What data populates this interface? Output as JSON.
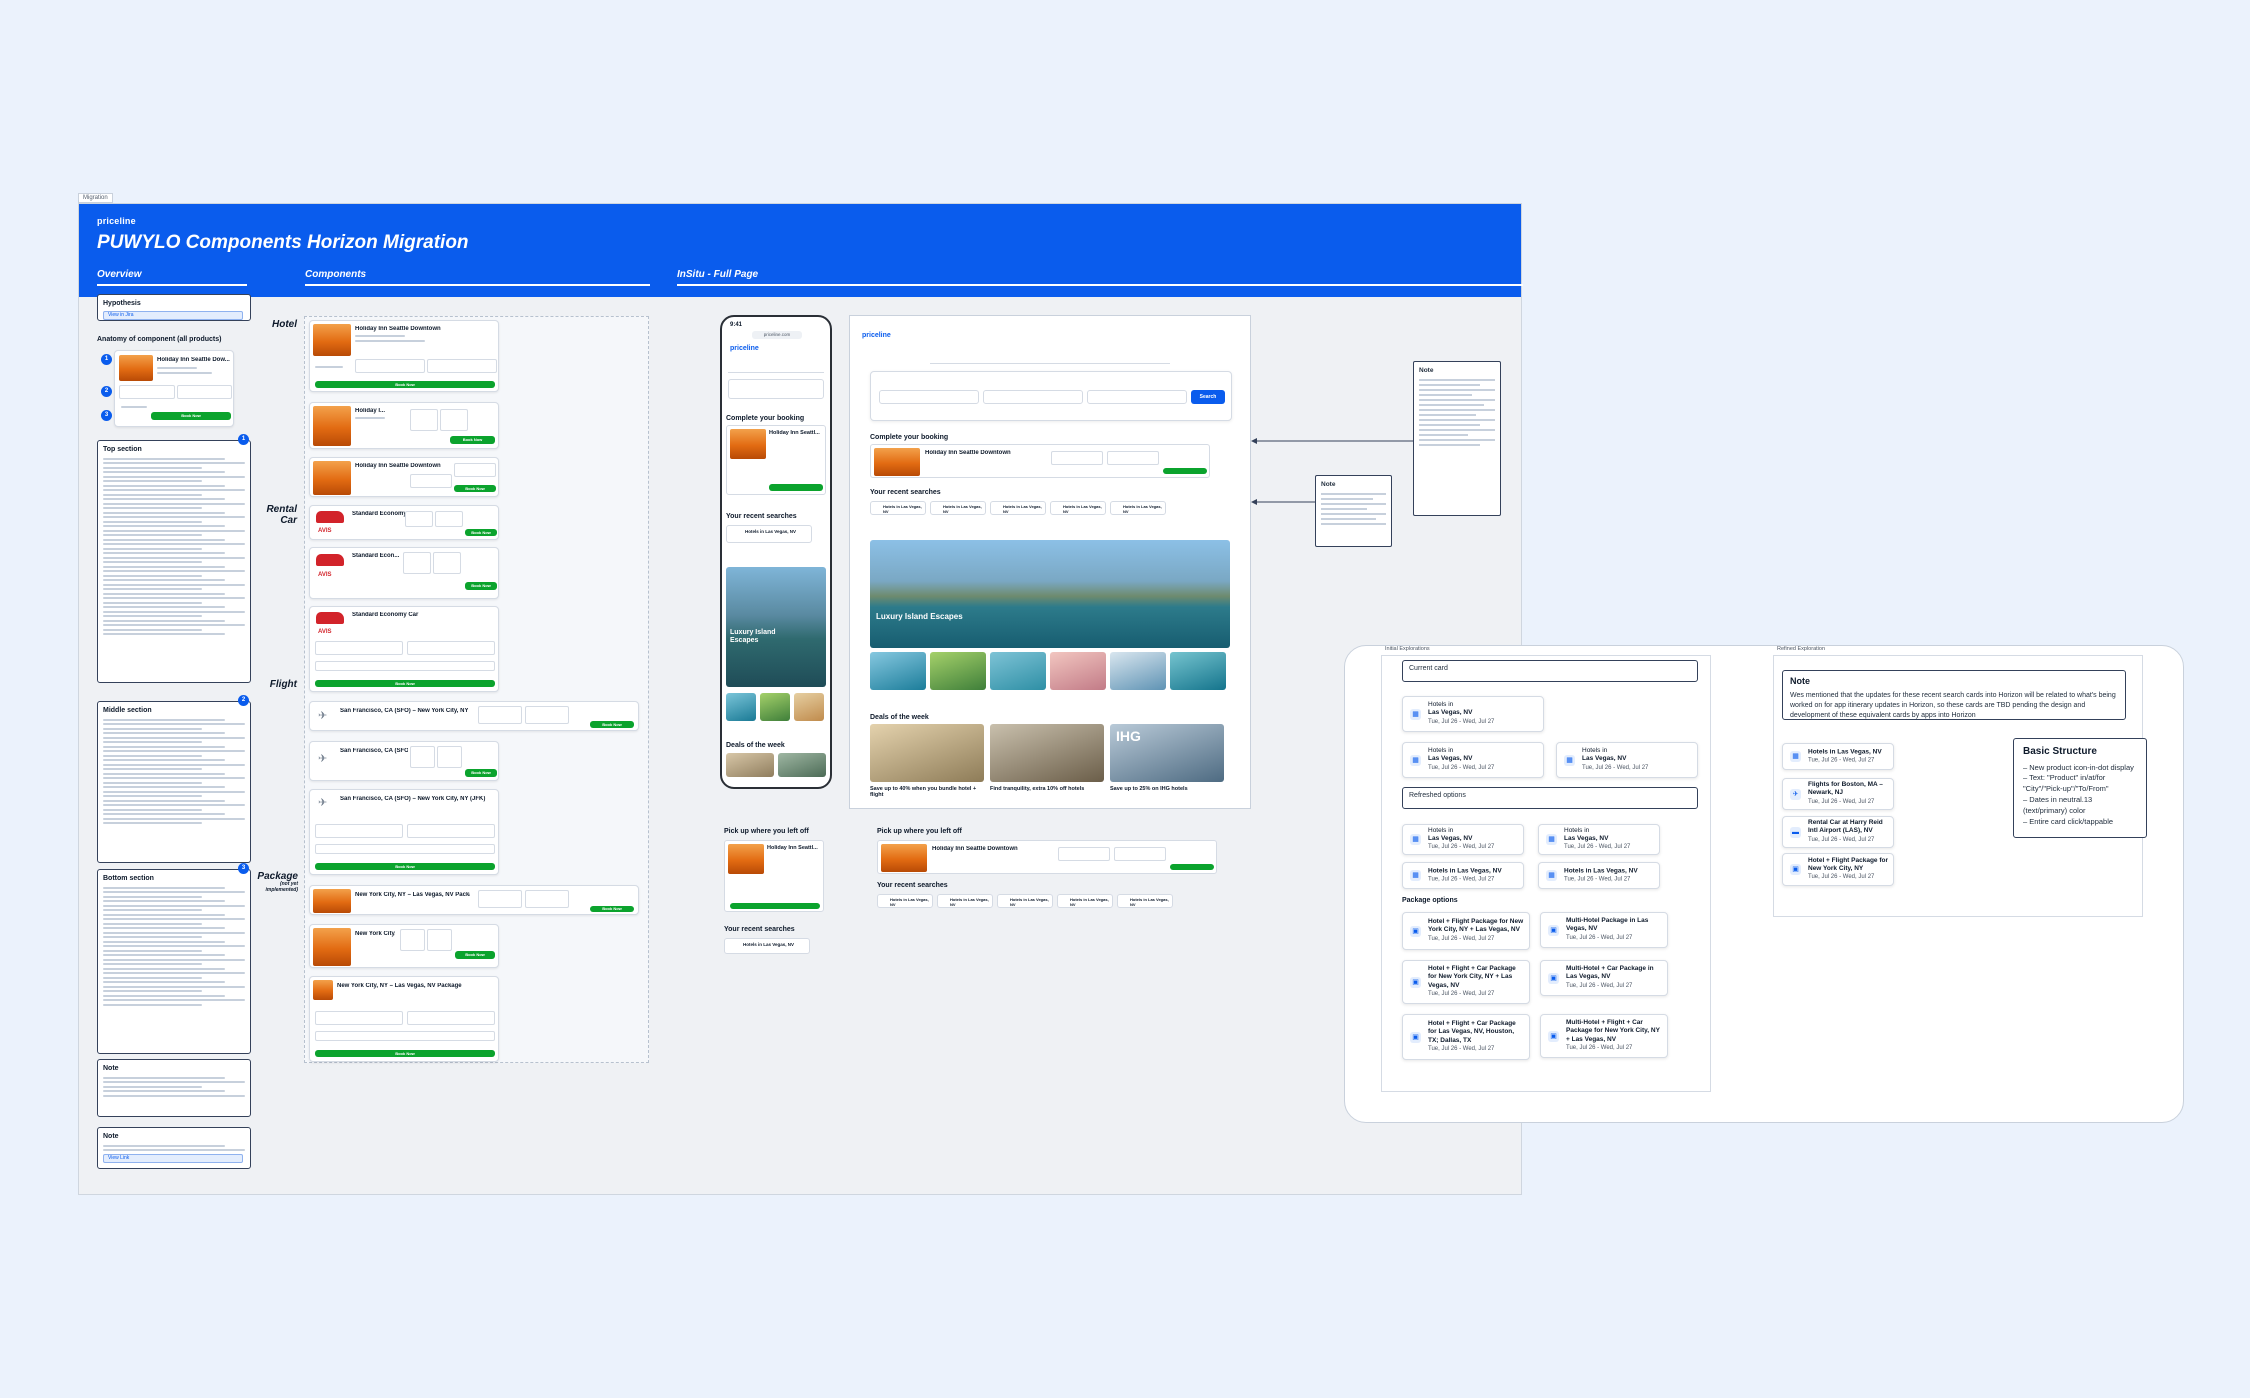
{
  "board": {
    "tag": "Migration",
    "brand": "priceline",
    "title": "PUWYLO Components Horizon Migration",
    "sections": {
      "overview": "Overview",
      "components": "Components",
      "insitu": "InSitu - Full Page"
    }
  },
  "overview": {
    "hypothesis_title": "Hypothesis",
    "hypothesis_link": "View in Jira",
    "anatomy_title": "Anatomy of component (all products)",
    "anatomy_hotel": "Holiday Inn Seattle Dow...",
    "anatomy_button": "Book Now",
    "numbers": [
      "1",
      "2",
      "3"
    ],
    "top_section_title": "Top section",
    "middle_section_title": "Middle section",
    "bottom_section_title": "Bottom section",
    "note_title": "Note",
    "note2_title": "Note",
    "note2_link": "View Link"
  },
  "components": {
    "categories": {
      "hotel": "Hotel",
      "car": "Rental Car",
      "flight": "Flight",
      "package": "Package",
      "package_sub": "(not yet implemented)"
    },
    "hotel_cards": [
      "Holiday Inn Seattle Downtown",
      "Holiday I...",
      "Holiday Inn Seattle Downtown"
    ],
    "car_cards": [
      "Standard Economy Car",
      "Standard Econ...",
      "Standard Economy Car"
    ],
    "flight_cards": [
      "San Francisco, CA (SFO) – New York City, NY (JFK)",
      "San Francisco, CA (SFO) – Ne...",
      "San Francisco, CA (SFO) – New York City, NY (JFK)"
    ],
    "package_cards": [
      "New York City, NY – Las Vegas, NV Package",
      "New York City, NY...",
      "New York City, NY – Las Vegas, NV Package"
    ],
    "book_now": "Book Now",
    "avis": "AVIS"
  },
  "mobile": {
    "time": "9:41",
    "url": "priceline.com",
    "brand": "priceline",
    "complete_booking": "Complete your booking",
    "hotel_name": "Holiday Inn Seattl...",
    "recent_searches": "Your recent searches",
    "recent_item": "Hotels in Las Vegas, NV",
    "hero_title": "Luxury Island Escapes",
    "deals": "Deals of the week",
    "pick_up": "Pick up where you left off",
    "recent_searches_2": "Your recent searches"
  },
  "desktop": {
    "brand": "priceline",
    "complete_booking": "Complete your booking",
    "hotel_name": "Holiday Inn Seattle Downtown",
    "recent_searches": "Your recent searches",
    "recent_item": "Hotels in Las Vegas, NV",
    "hero_title": "Luxury Island Escapes",
    "deals": "Deals of the week",
    "deal_captions": [
      "Save up to 40% when you bundle hotel + flight",
      "Find tranquility, extra 10% off hotels",
      "Save up to 25% on IHG hotels"
    ],
    "ihg": "IHG",
    "pick_up": "Pick up where you left off",
    "pick_hotel": "Holiday Inn Seattle Downtown",
    "recent_searches_2": "Your recent searches",
    "search_button": "Search"
  },
  "notes": {
    "note_a_title": "Note",
    "note_b_title": "Note"
  },
  "exploration": {
    "initial_tag": "Initial Explorations",
    "refined_tag": "Refined Exploration",
    "current_card": "Current card",
    "refreshed_options": "Refreshed options",
    "package_options": "Package options",
    "current_cards": [
      {
        "l1": "Hotels in",
        "l1b": "Las Vegas, NV",
        "l2": "Tue, Jul 26 - Wed, Jul 27"
      },
      {
        "l1": "Hotels in",
        "l1b": "Las Vegas, NV",
        "l2": "Tue, Jul 26 - Wed, Jul 27"
      },
      {
        "l1": "Hotels in",
        "l1b": "Las Vegas, NV",
        "l2": "Tue, Jul 26 - Wed, Jul 27"
      }
    ],
    "refreshed_cards": [
      {
        "l1": "Hotels in",
        "l1b": "Las Vegas, NV",
        "l2": "Tue, Jul 26 - Wed, Jul 27"
      },
      {
        "l1": "Hotels in",
        "l1b": "Las Vegas, NV",
        "l2": "Tue, Jul 26 - Wed, Jul 27"
      },
      {
        "l1": "",
        "l1b": "Hotels in Las Vegas, NV",
        "l2": "Tue, Jul 26 - Wed, Jul 27"
      },
      {
        "l1": "",
        "l1b": "Hotels in Las Vegas, NV",
        "l2": "Tue, Jul 26 - Wed, Jul 27"
      }
    ],
    "package_cards": [
      {
        "l1b": "Hotel + Flight Package for New York City, NY + Las Vegas, NV",
        "l2": "Tue, Jul 26 - Wed, Jul 27"
      },
      {
        "l1b": "Multi-Hotel Package in Las Vegas, NV",
        "l2": "Tue, Jul 26 - Wed, Jul 27"
      },
      {
        "l1b": "Hotel + Flight + Car Package for New York City, NY + Las Vegas, NV",
        "l2": "Tue, Jul 26 - Wed, Jul 27"
      },
      {
        "l1b": "Multi-Hotel + Car Package in Las Vegas, NV",
        "l2": "Tue, Jul 26 - Wed, Jul 27"
      },
      {
        "l1b": "Hotel + Flight + Car Package for Las Vegas, NV, Houston, TX; Dallas, TX",
        "l2": "Tue, Jul 26 - Wed, Jul 27"
      },
      {
        "l1b": "Multi-Hotel + Flight + Car Package for New York City, NY + Las Vegas, NV",
        "l2": "Tue, Jul 26 - Wed, Jul 27"
      }
    ],
    "refined_note_title": "Note",
    "refined_note_text": "Wes mentioned that the updates for these recent search cards into Horizon will be related to what's being worked on for app itinerary updates in Horizon, so these cards are TBD pending the design and development of these equivalent cards by apps into Horizon",
    "refined_cards": [
      {
        "l1b": "Hotels in Las Vegas, NV",
        "l2": "Tue, Jul 26 - Wed, Jul 27"
      },
      {
        "l1b": "Flights for Boston, MA – Newark, NJ",
        "l2": "Tue, Jul 26 - Wed, Jul 27"
      },
      {
        "l1b": "Rental Car at Harry Reid Intl Airport (LAS), NV",
        "l2": "Tue, Jul 26 - Wed, Jul 27"
      },
      {
        "l1b": "Hotel + Flight Package for New York City, NY",
        "l2": "Tue, Jul 26 - Wed, Jul 27"
      }
    ],
    "basic_title": "Basic Structure",
    "basic_items": [
      "– New product icon-in-dot display",
      "– Text: \"Product\" in/at/for \"City\"/\"Pick-up\"/\"To/From\"",
      "– Dates in neutral.13 (text/primary) color",
      "– Entire card click/tappable"
    ]
  },
  "colors": {
    "brand_blue": "#0a5ced",
    "book_green": "#0ba32d",
    "avis_red": "#d2232a"
  }
}
